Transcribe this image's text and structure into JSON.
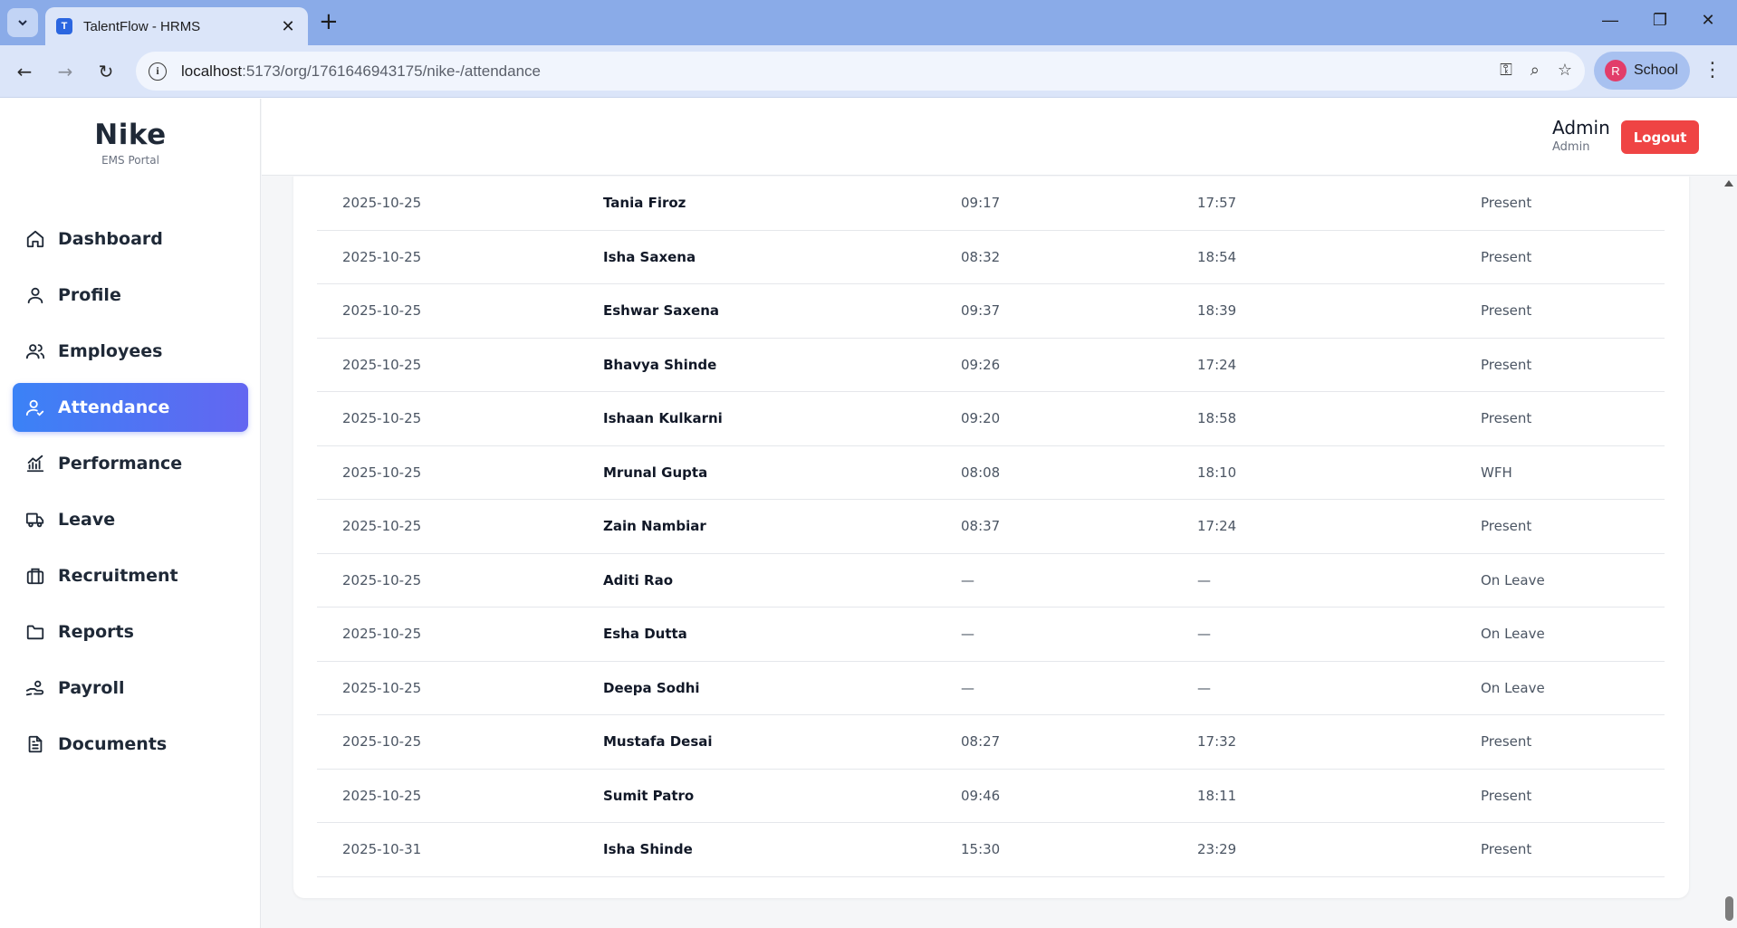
{
  "browser": {
    "tab_title": "TalentFlow - HRMS",
    "tab_favicon_letter": "T",
    "url_host": "localhost",
    "url_path": ":5173/org/1761646943175/nike-/attendance",
    "profile_initial": "R",
    "profile_label": "School"
  },
  "brand": {
    "name": "Nike",
    "subtitle": "EMS Portal"
  },
  "nav": [
    {
      "label": "Dashboard",
      "icon": "home-icon"
    },
    {
      "label": "Profile",
      "icon": "user-icon"
    },
    {
      "label": "Employees",
      "icon": "users-icon"
    },
    {
      "label": "Attendance",
      "icon": "user-check-icon",
      "active": true
    },
    {
      "label": "Performance",
      "icon": "chart-icon"
    },
    {
      "label": "Leave",
      "icon": "truck-icon"
    },
    {
      "label": "Recruitment",
      "icon": "briefcase-icon"
    },
    {
      "label": "Reports",
      "icon": "folder-icon"
    },
    {
      "label": "Payroll",
      "icon": "hand-coins-icon"
    },
    {
      "label": "Documents",
      "icon": "document-icon"
    }
  ],
  "header": {
    "user_name": "Admin",
    "user_role": "Admin",
    "logout_label": "Logout"
  },
  "attendance": {
    "rows": [
      {
        "date": "2025-10-25",
        "name": "Tania Firoz",
        "in": "09:17",
        "out": "17:57",
        "status": "Present"
      },
      {
        "date": "2025-10-25",
        "name": "Isha Saxena",
        "in": "08:32",
        "out": "18:54",
        "status": "Present"
      },
      {
        "date": "2025-10-25",
        "name": "Eshwar Saxena",
        "in": "09:37",
        "out": "18:39",
        "status": "Present"
      },
      {
        "date": "2025-10-25",
        "name": "Bhavya Shinde",
        "in": "09:26",
        "out": "17:24",
        "status": "Present"
      },
      {
        "date": "2025-10-25",
        "name": "Ishaan Kulkarni",
        "in": "09:20",
        "out": "18:58",
        "status": "Present"
      },
      {
        "date": "2025-10-25",
        "name": "Mrunal Gupta",
        "in": "08:08",
        "out": "18:10",
        "status": "WFH"
      },
      {
        "date": "2025-10-25",
        "name": "Zain Nambiar",
        "in": "08:37",
        "out": "17:24",
        "status": "Present"
      },
      {
        "date": "2025-10-25",
        "name": "Aditi Rao",
        "in": "—",
        "out": "—",
        "status": "On Leave"
      },
      {
        "date": "2025-10-25",
        "name": "Esha Dutta",
        "in": "—",
        "out": "—",
        "status": "On Leave"
      },
      {
        "date": "2025-10-25",
        "name": "Deepa Sodhi",
        "in": "—",
        "out": "—",
        "status": "On Leave"
      },
      {
        "date": "2025-10-25",
        "name": "Mustafa Desai",
        "in": "08:27",
        "out": "17:32",
        "status": "Present"
      },
      {
        "date": "2025-10-25",
        "name": "Sumit Patro",
        "in": "09:46",
        "out": "18:11",
        "status": "Present"
      },
      {
        "date": "2025-10-31",
        "name": "Isha Shinde",
        "in": "15:30",
        "out": "23:29",
        "status": "Present"
      }
    ]
  }
}
